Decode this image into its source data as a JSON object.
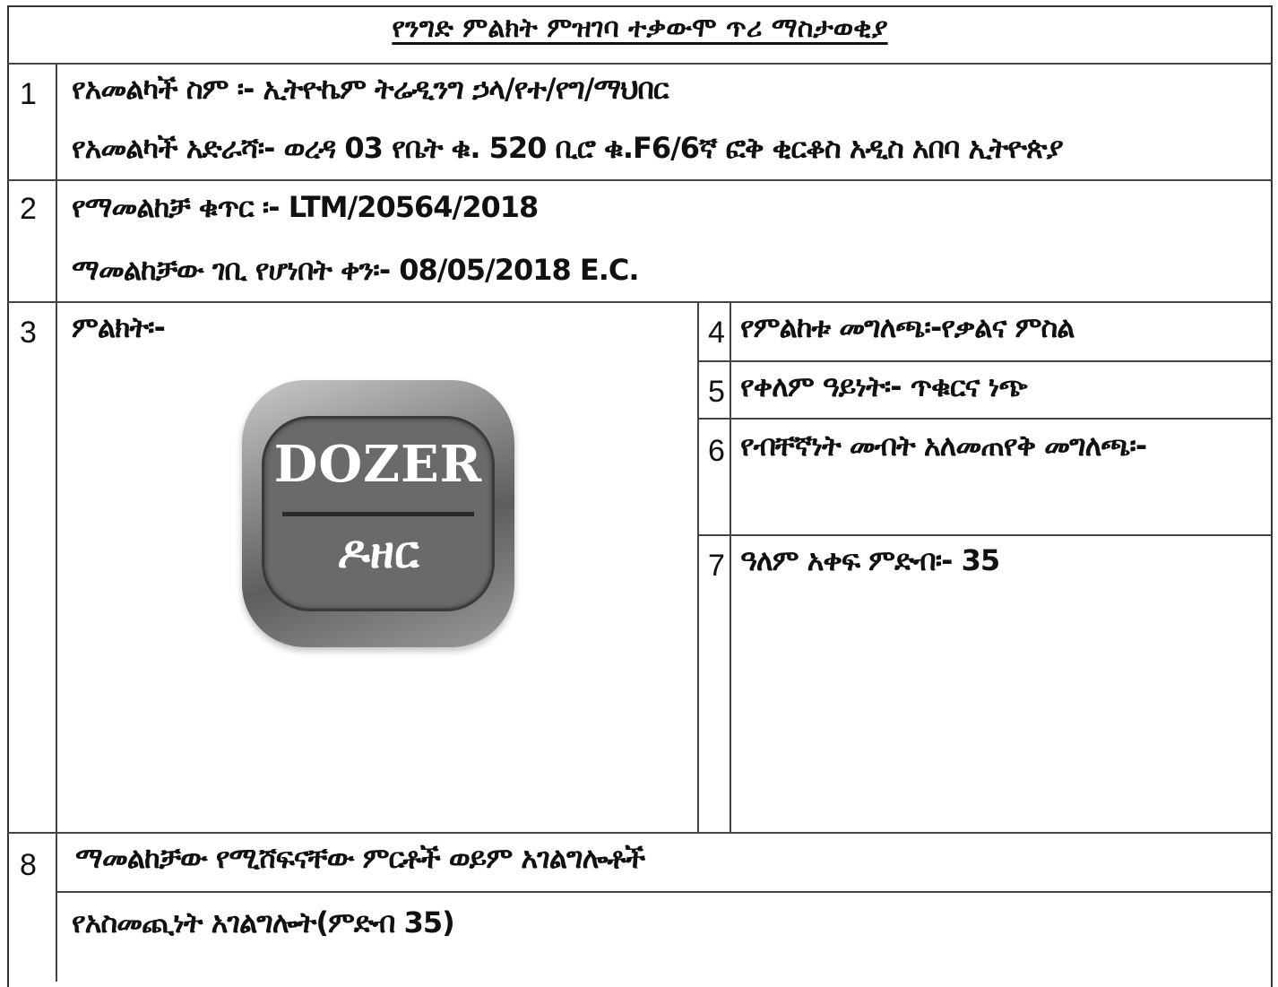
{
  "title": "የንግድ ምልክት ምዝገባ ተቃውሞ ጥሪ ማስታወቂያ",
  "rows": {
    "r1": {
      "num": "1",
      "applicant_name": "የአመልካች ስም ፡- ኢትዮኬም ትሬዲንግ ኃላ/የተ/የግ/ማህበር",
      "applicant_address": "የአመልካች አድራሻ፡- ወረዳ 03 የቤት ቁ. 520 ቢሮ ቁ.F6/6ኛ ፎቅ ቂርቆስ አዲስ አበባ ኢትዮጵያ"
    },
    "r2": {
      "num": "2",
      "application_number": "የማመልከቻ ቁጥር ፡- LTM/20564/2018",
      "filing_date": "ማመልከቻው ገቢ የሆነበት ቀን፡- 08/05/2018 E.C."
    },
    "r3": {
      "num": "3",
      "mark_label": "ምልክት፡-"
    },
    "r4": {
      "num": "4",
      "text": "የምልከቱ መግለጫ፡-የቃልና ምስል"
    },
    "r5": {
      "num": "5",
      "text": "የቀለም ዓይነት፡- ጥቁርና ነጭ"
    },
    "r6": {
      "num": "6",
      "text": "የብቸኛነት መብት አለመጠየቅ መግለጫ፡-"
    },
    "r7": {
      "num": "7",
      "text": "ዓለም አቀፍ ምድብ፡- 35"
    },
    "r8": {
      "num": "8",
      "goods_label": "ማመልከቻው የሚሸፍናቸው ምርቶች ወይም አገልግሎቶች",
      "goods_value": "የአስመጪነት አገልግሎት(ምድብ 35)"
    }
  },
  "logo": {
    "top_text": "DOZER",
    "bottom_text": "ዶዘር"
  }
}
